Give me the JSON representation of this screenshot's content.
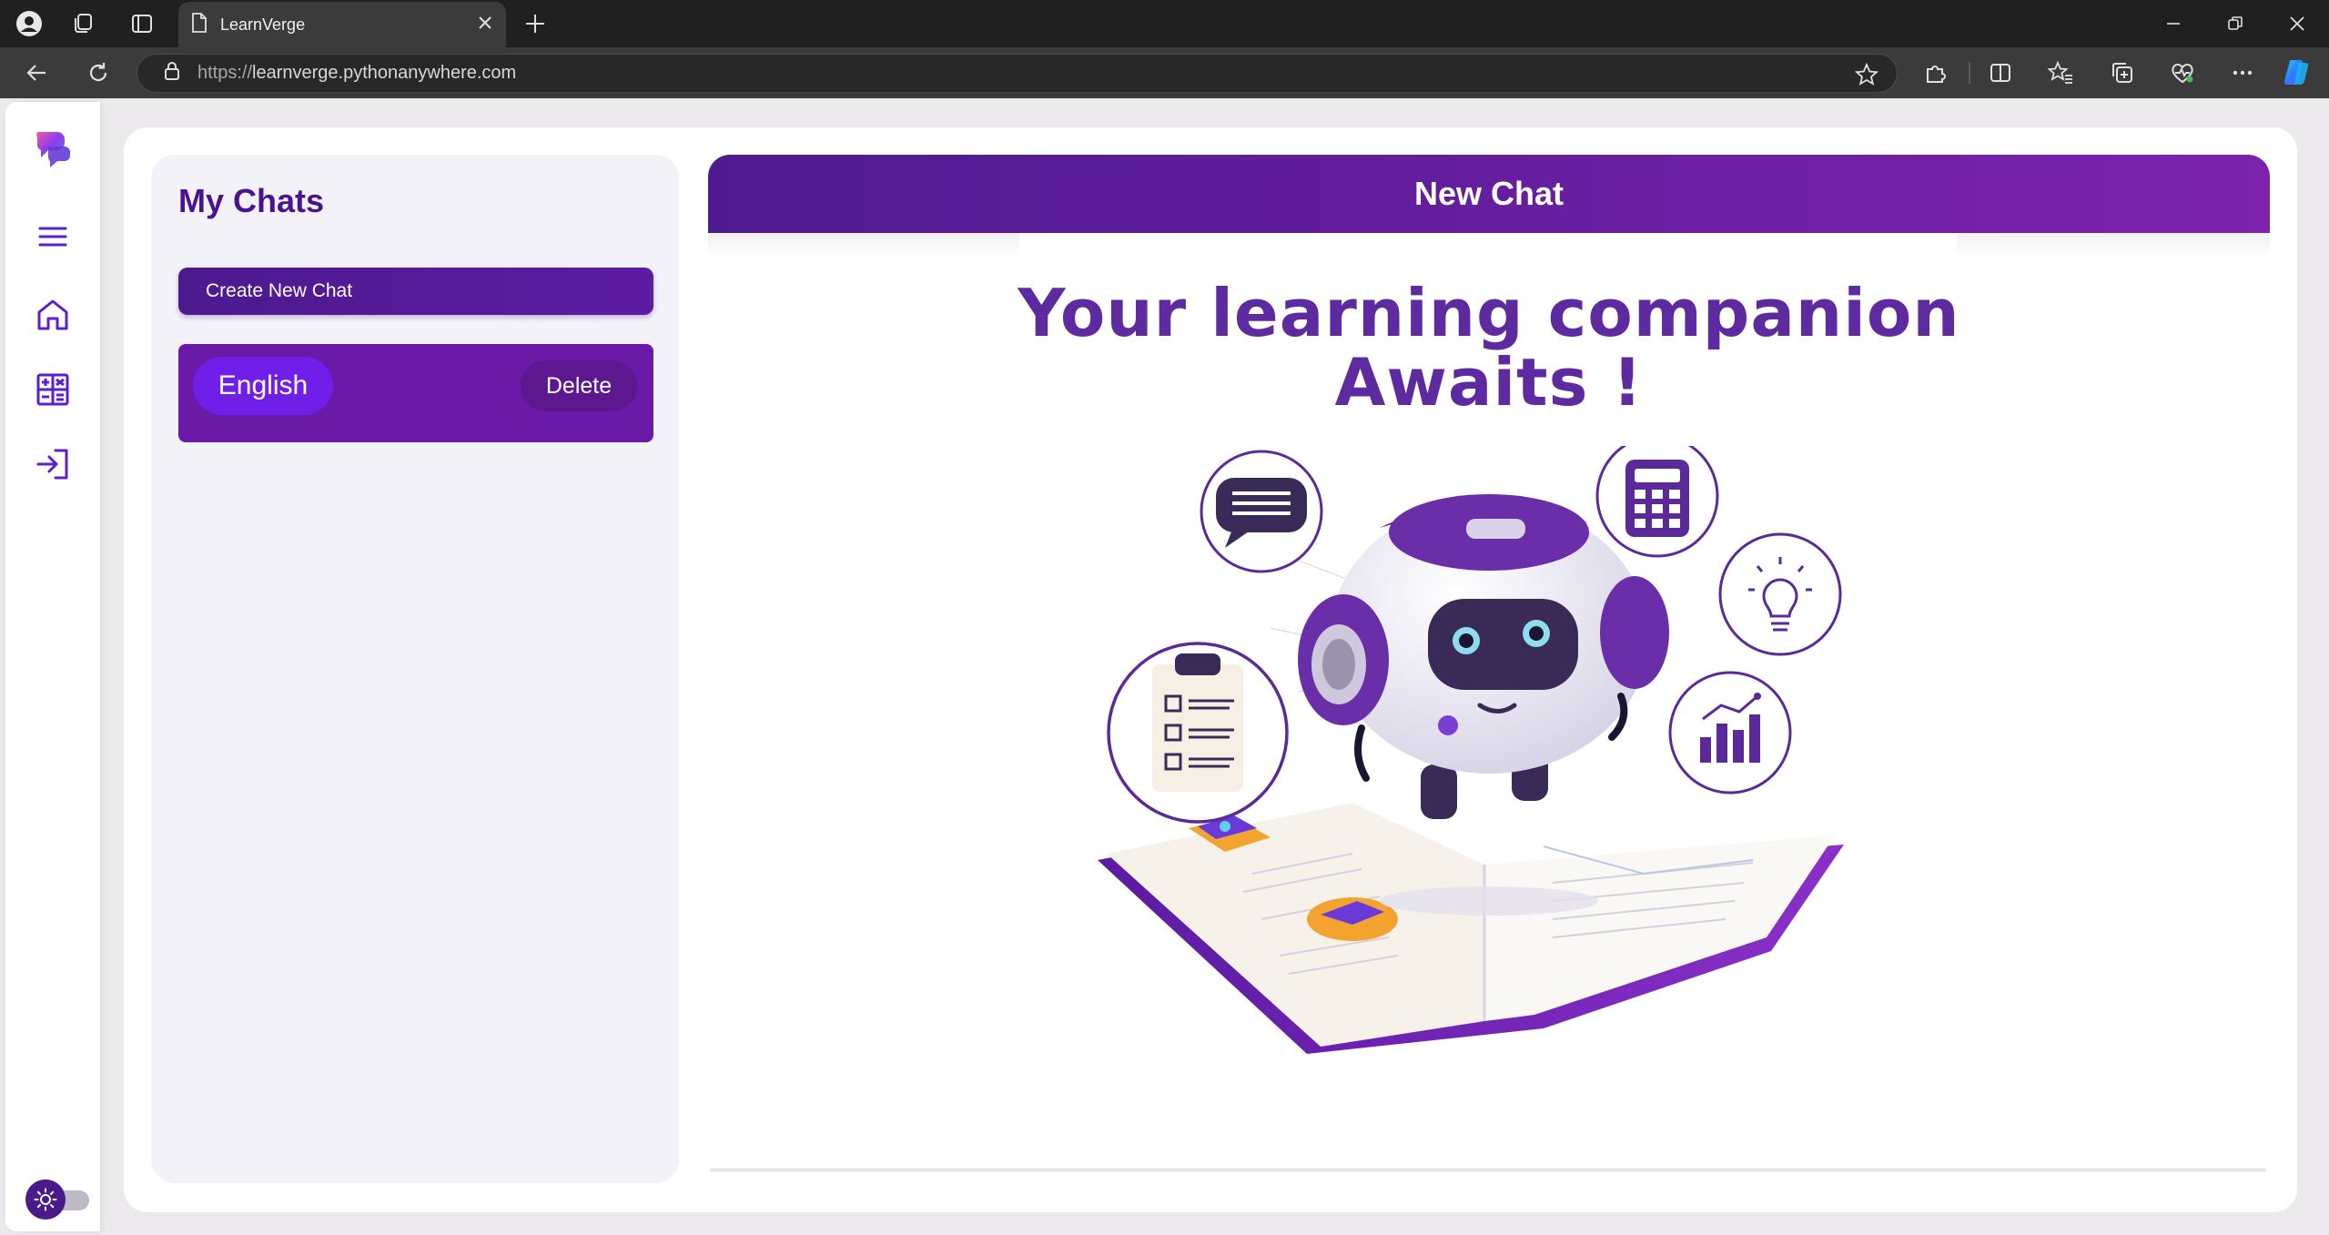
{
  "browser": {
    "tab_title": "LearnVerge",
    "url_protocol": "https://",
    "url_host": "learnverge.pythonanywhere.com",
    "icons": {
      "profile": "profile-icon",
      "workspaces": "workspaces-icon",
      "tab_actions": "tab-actions-icon",
      "page": "page-icon",
      "close_tab": "close-icon",
      "new_tab": "plus-icon",
      "minimize": "minimize-icon",
      "restore": "restore-icon",
      "close_window": "close-icon",
      "back": "back-arrow-icon",
      "refresh": "refresh-icon",
      "lock": "lock-icon",
      "favorite": "star-icon",
      "extensions": "puzzle-icon",
      "split_screen": "split-screen-icon",
      "favorites": "favorites-icon",
      "collections": "collections-icon",
      "health": "heart-pulse-icon",
      "more": "more-icon",
      "copilot": "copilot-icon"
    }
  },
  "sidebar": {
    "items": [
      {
        "name": "logo",
        "icon": "logo-icon"
      },
      {
        "name": "menu",
        "icon": "hamburger-icon"
      },
      {
        "name": "home",
        "icon": "home-icon"
      },
      {
        "name": "calculator",
        "icon": "calculator-icon"
      },
      {
        "name": "login",
        "icon": "login-icon"
      }
    ],
    "theme_toggle_icon": "sun-icon"
  },
  "chats_panel": {
    "title": "My Chats",
    "create_button": "Create New Chat",
    "chats": [
      {
        "name": "English",
        "delete_label": "Delete"
      }
    ]
  },
  "chat_area": {
    "header_title": "New Chat",
    "welcome_line1": "Your learning companion",
    "welcome_line2": "Awaits !",
    "hero_image": "robot-on-book-illustration"
  },
  "colors": {
    "primary_purple": "#4d1a8e",
    "accent_violet": "#6f1fe8",
    "header_gradient_end": "#7c22ad",
    "heading_text": "#5d2aa0"
  }
}
